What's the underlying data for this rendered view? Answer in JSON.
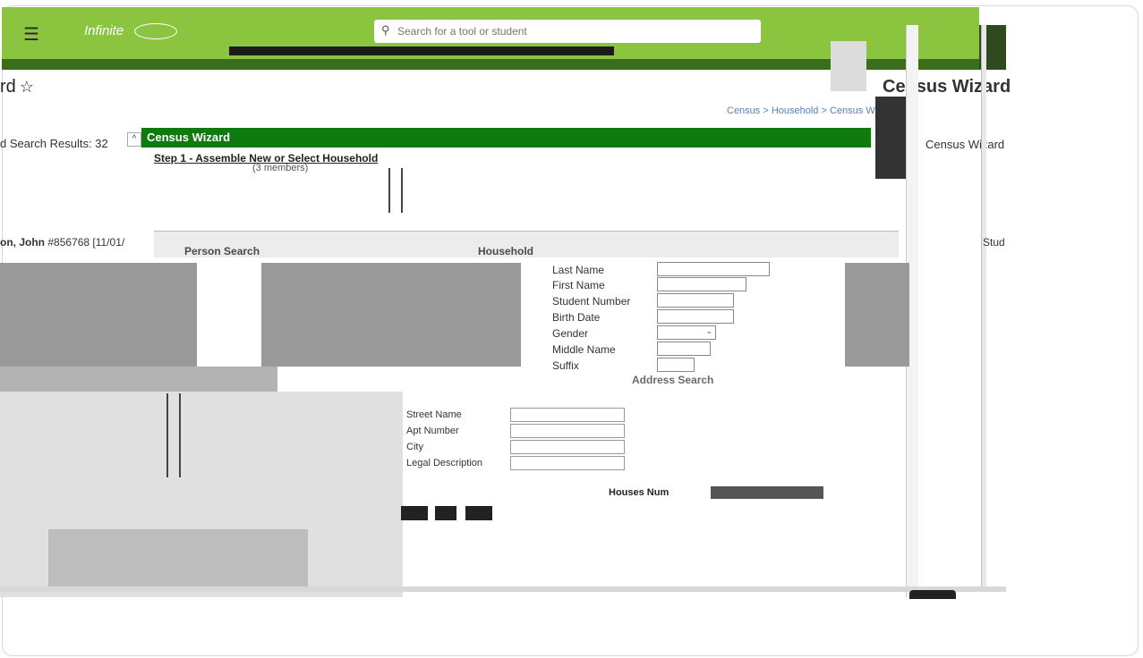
{
  "header": {
    "brand": "Infinite",
    "search_placeholder": "Search for a tool or student"
  },
  "page": {
    "title": "rd",
    "star": "☆",
    "breadcrumb": "Census > Household > Census Wizard",
    "right_title": "Census Wizard"
  },
  "results": {
    "label": "d Search Results: 32",
    "collapse": "^",
    "person_name": "on, John",
    "person_detail": "#856768  [11/01/"
  },
  "wizard": {
    "header": "Census Wizard",
    "step_title": "Step 1 - Assemble New or Select Household",
    "step_members": "(3 members)",
    "right_label": "Census Wizard",
    "right_stud": "Stud"
  },
  "panel": {
    "tab_person_search": "Person Search",
    "tab_household": "Household"
  },
  "form": {
    "fields": [
      {
        "label": "Last Name"
      },
      {
        "label": "First Name"
      },
      {
        "label": "Student Number"
      },
      {
        "label": "Birth Date"
      },
      {
        "label": "Gender"
      },
      {
        "label": "Middle Name"
      },
      {
        "label": "Suffix"
      }
    ],
    "address_search": "Address Search"
  },
  "address": {
    "rows": [
      "Street Name",
      "Apt Number",
      "City",
      "Legal Description"
    ]
  },
  "houses": {
    "label": "Houses Num"
  },
  "colors": {
    "top_green": "#8bc540",
    "wizard_green": "#0f7a0f",
    "dark_strip": "#3a6e1f"
  }
}
